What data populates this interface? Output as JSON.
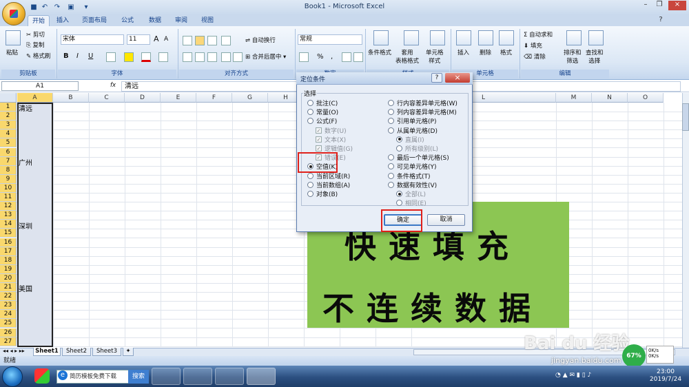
{
  "window": {
    "title": "Book1 - Microsoft Excel"
  },
  "tabs": [
    "开始",
    "插入",
    "页面布局",
    "公式",
    "数据",
    "审阅",
    "视图"
  ],
  "ribbon": {
    "clipboard": {
      "paste": "粘贴",
      "cut": "剪切",
      "copy": "复制",
      "format_painter": "格式刷",
      "label": "剪贴板"
    },
    "font": {
      "name": "宋体",
      "size": "11",
      "label": "字体",
      "bold": "B",
      "italic": "I",
      "underline": "U",
      "grow": "A",
      "shrink": "A"
    },
    "alignment": {
      "wrap": "自动换行",
      "merge": "合并后居中",
      "label": "对齐方式"
    },
    "number": {
      "format": "常规",
      "percent": "%",
      "comma": ",",
      "label": "数字"
    },
    "styles": {
      "conditional": "条件格式",
      "table": "套用\n表格格式",
      "cell": "单元格\n样式",
      "label": "样式"
    },
    "cells": {
      "insert": "插入",
      "delete": "删除",
      "format": "格式",
      "label": "单元格"
    },
    "editing": {
      "autosum": "Σ 自动求和",
      "fill": "填充",
      "clear": "清除",
      "sort": "排序和\n筛选",
      "find": "查找和\n选择",
      "label": "编辑"
    }
  },
  "formula_bar": {
    "name_box": "A1",
    "fx": "fx",
    "content": "清远"
  },
  "columns": [
    "A",
    "B",
    "C",
    "D",
    "E",
    "F",
    "G",
    "H",
    "I",
    "J",
    "K",
    "L",
    "M",
    "N",
    "O"
  ],
  "rows": [
    "1",
    "2",
    "3",
    "4",
    "5",
    "6",
    "7",
    "8",
    "9",
    "10",
    "11",
    "12",
    "13",
    "14",
    "15",
    "16",
    "17",
    "18",
    "19",
    "20",
    "21",
    "22",
    "23",
    "24",
    "25",
    "26",
    "27"
  ],
  "cells": {
    "r1": "清远",
    "r7": "广州",
    "r14": "深圳",
    "r21": "美国"
  },
  "sheets": [
    "Sheet1",
    "Sheet2",
    "Sheet3"
  ],
  "status": {
    "text": "就绪"
  },
  "overlay": {
    "line1": "快速填充",
    "line2": "不连续数据"
  },
  "watermark": {
    "brand": "Bai du 经验",
    "url": "jingyan.baidu.com"
  },
  "speed": {
    "percent": "67%",
    "up": "0K/s",
    "down": "0K/s"
  },
  "dialog": {
    "title": "定位条件",
    "help": "?",
    "close": "×",
    "group": "选择",
    "left": [
      {
        "label": "批注(C)",
        "type": "radio",
        "on": false,
        "dis": false
      },
      {
        "label": "常量(O)",
        "type": "radio",
        "on": false,
        "dis": false
      },
      {
        "label": "公式(F)",
        "type": "radio",
        "on": false,
        "dis": false
      },
      {
        "label": "数字(U)",
        "type": "chk",
        "on": true,
        "dis": true
      },
      {
        "label": "文本(X)",
        "type": "chk",
        "on": true,
        "dis": true
      },
      {
        "label": "逻辑值(G)",
        "type": "chk",
        "on": true,
        "dis": true
      },
      {
        "label": "错误(E)",
        "type": "chk",
        "on": true,
        "dis": true
      },
      {
        "label": "空值(K)",
        "type": "radio",
        "on": true,
        "dis": false
      },
      {
        "label": "当前区域(R)",
        "type": "radio",
        "on": false,
        "dis": false
      },
      {
        "label": "当前数组(A)",
        "type": "radio",
        "on": false,
        "dis": false
      },
      {
        "label": "对象(B)",
        "type": "radio",
        "on": false,
        "dis": false
      }
    ],
    "right": [
      {
        "label": "行内容差异单元格(W)",
        "type": "radio",
        "on": false,
        "dis": false
      },
      {
        "label": "列内容差异单元格(M)",
        "type": "radio",
        "on": false,
        "dis": false
      },
      {
        "label": "引用单元格(P)",
        "type": "radio",
        "on": false,
        "dis": false
      },
      {
        "label": "从属单元格(D)",
        "type": "radio",
        "on": false,
        "dis": false
      },
      {
        "label": "直属(I)",
        "type": "radio",
        "on": true,
        "dis": true
      },
      {
        "label": "所有级别(L)",
        "type": "radio",
        "on": false,
        "dis": true
      },
      {
        "label": "最后一个单元格(S)",
        "type": "radio",
        "on": false,
        "dis": false
      },
      {
        "label": "可见单元格(Y)",
        "type": "radio",
        "on": false,
        "dis": false
      },
      {
        "label": "条件格式(T)",
        "type": "radio",
        "on": false,
        "dis": false
      },
      {
        "label": "数据有效性(V)",
        "type": "radio",
        "on": false,
        "dis": false
      },
      {
        "label": "全部(L)",
        "type": "radio",
        "on": true,
        "dis": true
      },
      {
        "label": "相同(E)",
        "type": "radio",
        "on": false,
        "dis": true
      }
    ],
    "ok": "确定",
    "cancel": "取消"
  },
  "taskbar": {
    "search_placeholder": "简历模板免费下载",
    "search_btn": "搜索",
    "time": "23:00",
    "date": "2019/7/24"
  },
  "colors": {
    "ribbon": "#dbe7f5",
    "green": "#8cc653",
    "highlight": "#e0201a",
    "selection": "#f9d86d"
  }
}
